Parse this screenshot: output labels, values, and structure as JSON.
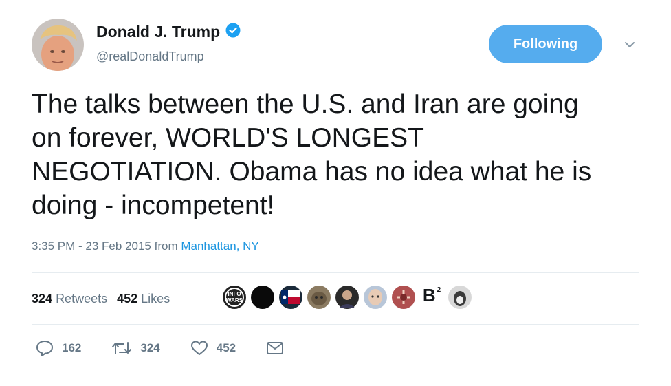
{
  "user": {
    "display_name": "Donald J. Trump",
    "handle": "@realDonaldTrump",
    "verified": true
  },
  "follow_button": {
    "label": "Following"
  },
  "tweet": {
    "text": "The talks between the U.S. and Iran are going\non forever,  WORLD'S LONGEST\nNEGOTIATION. Obama has no idea what he is\ndoing - incompetent!",
    "time": "3:35 PM - 23 Feb 2015",
    "from_label": "from",
    "location": "Manhattan, NY"
  },
  "stats": {
    "retweets_count": "324",
    "retweets_label": "Retweets",
    "likes_count": "452",
    "likes_label": "Likes"
  },
  "likers": {
    "b2_label": "B",
    "b2_sup": "2"
  },
  "actions": {
    "reply_count": "162",
    "retweet_count": "324",
    "like_count": "452"
  },
  "colors": {
    "accent": "#55acee",
    "link": "#1b95e0",
    "muted": "#657786"
  }
}
